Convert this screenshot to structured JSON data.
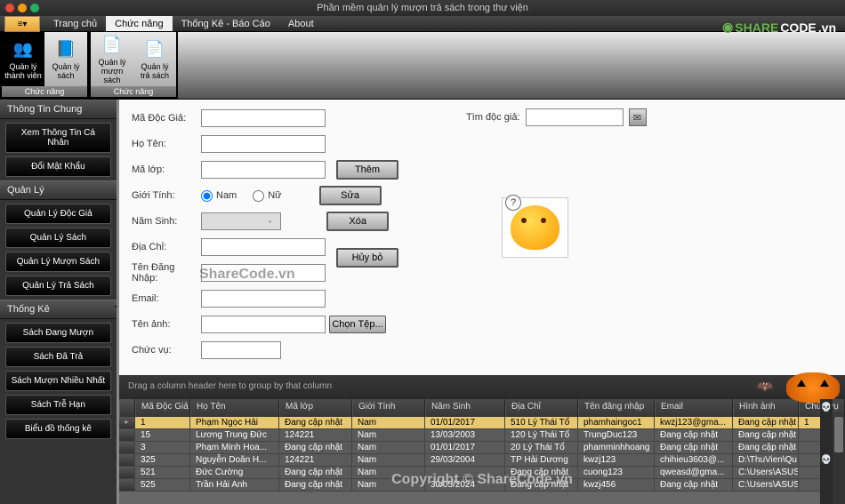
{
  "app": {
    "title": "Phần mềm quản lý mượn trả sách trong thư viện"
  },
  "watermark": {
    "logo_a": "SHARE",
    "logo_b": "CODE",
    "logo_c": ".vn",
    "center": "ShareCode.vn",
    "copyright": "Copyright © ShareCode.vn"
  },
  "menu": {
    "tabs": [
      "Trang chủ",
      "Chức năng",
      "Thống Kê - Báo Cáo",
      "About"
    ],
    "active_index": 1
  },
  "ribbon": {
    "groups": [
      {
        "label": "Chức năng",
        "items": [
          {
            "icon": "👥",
            "label": "Quản lý thành viên",
            "selected": true
          },
          {
            "icon": "📘",
            "label": "Quản lý sách"
          }
        ]
      },
      {
        "label": "Chức năng",
        "items": [
          {
            "icon": "📄",
            "label": "Quản lý mượn sách"
          },
          {
            "icon": "📄",
            "label": "Quản lý trả sách"
          }
        ]
      }
    ]
  },
  "sidebar": {
    "sections": [
      {
        "head": "Thông Tin Chung",
        "items": [
          "Xem Thông Tin Cá Nhân",
          "Đổi Mật Khẩu"
        ]
      },
      {
        "head": "Quản Lý",
        "items": [
          "Quản Lý Độc Giả",
          "Quản Lý Sách",
          "Quản Lý Mượn Sách",
          "Quản Lý Trả Sách"
        ]
      },
      {
        "head": "Thống Kê",
        "items": [
          "Sách Đang Mượn",
          "Sách Đã Trả",
          "Sách Mượn Nhiều Nhất",
          "Sách Trễ Hạn",
          "Biểu đồ thống kê"
        ]
      }
    ]
  },
  "form": {
    "ma_doc_gia_lbl": "Mã Độc Giả:",
    "ho_ten_lbl": "Họ Tên:",
    "ma_lop_lbl": "Mã lớp:",
    "gioi_tinh_lbl": "Giới Tính:",
    "nam_sinh_lbl": "Năm Sinh:",
    "dia_chi_lbl": "Địa Chỉ:",
    "ten_dang_nhap_lbl": "Tên Đăng Nhập:",
    "email_lbl": "Email:",
    "ten_anh_lbl": "Tên ảnh:",
    "chuc_vu_lbl": "Chức vụ:",
    "nam_lbl": "Nam",
    "nu_lbl": "Nữ",
    "search_lbl": "Tìm độc giả:",
    "btn_them": "Thêm",
    "btn_sua": "Sửa",
    "btn_xoa": "Xóa",
    "btn_huy": "Hủy bỏ",
    "btn_chon_tep": "Chọn Tệp..."
  },
  "grid": {
    "group_hint": "Drag a column header here to group by that column",
    "columns": [
      "Mã Độc Giả",
      "Họ Tên",
      "Mã lớp",
      "Giới Tính",
      "Năm Sinh",
      "Địa Chỉ",
      "Tên đăng nhập",
      "Email",
      "Hình ảnh",
      "Chức vụ"
    ],
    "rows": [
      {
        "sel": true,
        "c": [
          "1",
          "Phạm Ngọc Hải",
          "Đang cập nhật",
          "Nam",
          "01/01/2017",
          "510 Lý Thái Tổ",
          "phamhaingoc1",
          "kwzj123@gma...",
          "Đang cập nhật",
          "1"
        ]
      },
      {
        "sel": false,
        "c": [
          "15",
          "Lương Trung Đức",
          "124221",
          "Nam",
          "13/03/2003",
          "120 Lý Thái Tổ",
          "TrungDuc123",
          "Đang cập nhật",
          "Đang cập nhật",
          ""
        ]
      },
      {
        "sel": false,
        "c": [
          "3",
          "Phạm Minh Hoa...",
          "Đang cập nhật",
          "Nam",
          "01/01/2017",
          "20 Lý Thái Tổ",
          "phamminhhoang",
          "Đang cập nhật",
          "Đang cập nhật",
          ""
        ]
      },
      {
        "sel": false,
        "c": [
          "325",
          "Nguyễn Doãn H...",
          "124221",
          "Nam",
          "29/03/2004",
          "TP Hải Dương",
          "kwzj123",
          "chihieu3603@...",
          "D:\\ThuVien\\Qu...",
          ""
        ]
      },
      {
        "sel": false,
        "c": [
          "521",
          "Đức Cường",
          "Đang cập nhật",
          "Nam",
          "",
          "Đang cập nhật",
          "cuong123",
          "qweasd@gma...",
          "C:\\Users\\ASUS...",
          ""
        ]
      },
      {
        "sel": false,
        "c": [
          "525",
          "Trần Hải Anh",
          "Đang cập nhật",
          "Nam",
          "30/05/2024",
          "Đang cập nhật",
          "kwzj456",
          "Đang cập nhật",
          "C:\\Users\\ASUS...",
          ""
        ]
      }
    ]
  }
}
